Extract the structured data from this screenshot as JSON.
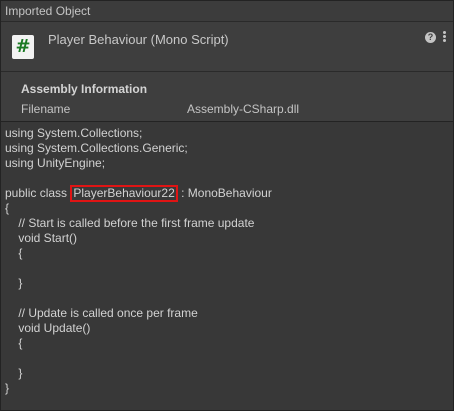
{
  "tab": {
    "title": "Imported Object"
  },
  "header": {
    "icon": "csharp-script-icon",
    "icon_glyph": "#",
    "title": "Player Behaviour (Mono Script)",
    "help_glyph": "?",
    "colors": {
      "icon_background": "#f2f2f2",
      "icon_glyph": "#1b7a24"
    }
  },
  "assembly": {
    "title": "Assembly Information",
    "filename_label": "Filename",
    "filename_value": "Assembly-CSharp.dll"
  },
  "code": {
    "lines": [
      "using System.Collections;",
      "using System.Collections.Generic;",
      "using UnityEngine;",
      "",
      "",
      "{",
      "    // Start is called before the first frame update",
      "    void Start()",
      "    {",
      "",
      "    }",
      "",
      "    // Update is called once per frame",
      "    void Update()",
      "    {",
      "",
      "    }",
      "}"
    ],
    "class_line": {
      "prefix": "public class ",
      "class_name": "PlayerBehaviour22",
      "suffix": " : MonoBehaviour"
    },
    "highlight_color": "#e01414"
  }
}
